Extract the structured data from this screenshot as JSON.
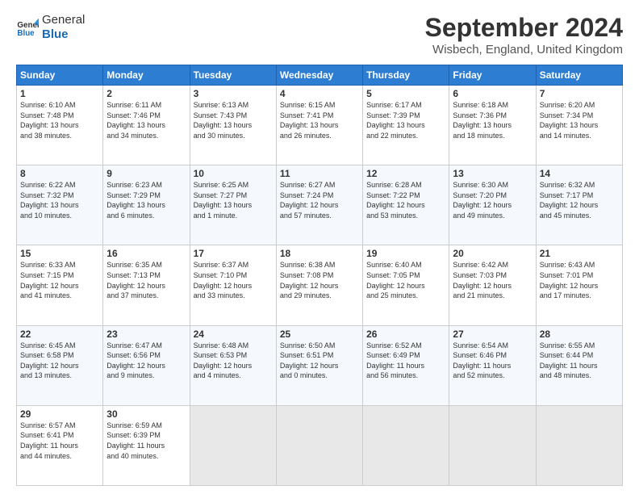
{
  "logo": {
    "general": "General",
    "blue": "Blue"
  },
  "title": "September 2024",
  "subtitle": "Wisbech, England, United Kingdom",
  "days_of_week": [
    "Sunday",
    "Monday",
    "Tuesday",
    "Wednesday",
    "Thursday",
    "Friday",
    "Saturday"
  ],
  "weeks": [
    [
      {
        "day": "1",
        "info": "Sunrise: 6:10 AM\nSunset: 7:48 PM\nDaylight: 13 hours\nand 38 minutes."
      },
      {
        "day": "2",
        "info": "Sunrise: 6:11 AM\nSunset: 7:46 PM\nDaylight: 13 hours\nand 34 minutes."
      },
      {
        "day": "3",
        "info": "Sunrise: 6:13 AM\nSunset: 7:43 PM\nDaylight: 13 hours\nand 30 minutes."
      },
      {
        "day": "4",
        "info": "Sunrise: 6:15 AM\nSunset: 7:41 PM\nDaylight: 13 hours\nand 26 minutes."
      },
      {
        "day": "5",
        "info": "Sunrise: 6:17 AM\nSunset: 7:39 PM\nDaylight: 13 hours\nand 22 minutes."
      },
      {
        "day": "6",
        "info": "Sunrise: 6:18 AM\nSunset: 7:36 PM\nDaylight: 13 hours\nand 18 minutes."
      },
      {
        "day": "7",
        "info": "Sunrise: 6:20 AM\nSunset: 7:34 PM\nDaylight: 13 hours\nand 14 minutes."
      }
    ],
    [
      {
        "day": "8",
        "info": "Sunrise: 6:22 AM\nSunset: 7:32 PM\nDaylight: 13 hours\nand 10 minutes."
      },
      {
        "day": "9",
        "info": "Sunrise: 6:23 AM\nSunset: 7:29 PM\nDaylight: 13 hours\nand 6 minutes."
      },
      {
        "day": "10",
        "info": "Sunrise: 6:25 AM\nSunset: 7:27 PM\nDaylight: 13 hours\nand 1 minute."
      },
      {
        "day": "11",
        "info": "Sunrise: 6:27 AM\nSunset: 7:24 PM\nDaylight: 12 hours\nand 57 minutes."
      },
      {
        "day": "12",
        "info": "Sunrise: 6:28 AM\nSunset: 7:22 PM\nDaylight: 12 hours\nand 53 minutes."
      },
      {
        "day": "13",
        "info": "Sunrise: 6:30 AM\nSunset: 7:20 PM\nDaylight: 12 hours\nand 49 minutes."
      },
      {
        "day": "14",
        "info": "Sunrise: 6:32 AM\nSunset: 7:17 PM\nDaylight: 12 hours\nand 45 minutes."
      }
    ],
    [
      {
        "day": "15",
        "info": "Sunrise: 6:33 AM\nSunset: 7:15 PM\nDaylight: 12 hours\nand 41 minutes."
      },
      {
        "day": "16",
        "info": "Sunrise: 6:35 AM\nSunset: 7:13 PM\nDaylight: 12 hours\nand 37 minutes."
      },
      {
        "day": "17",
        "info": "Sunrise: 6:37 AM\nSunset: 7:10 PM\nDaylight: 12 hours\nand 33 minutes."
      },
      {
        "day": "18",
        "info": "Sunrise: 6:38 AM\nSunset: 7:08 PM\nDaylight: 12 hours\nand 29 minutes."
      },
      {
        "day": "19",
        "info": "Sunrise: 6:40 AM\nSunset: 7:05 PM\nDaylight: 12 hours\nand 25 minutes."
      },
      {
        "day": "20",
        "info": "Sunrise: 6:42 AM\nSunset: 7:03 PM\nDaylight: 12 hours\nand 21 minutes."
      },
      {
        "day": "21",
        "info": "Sunrise: 6:43 AM\nSunset: 7:01 PM\nDaylight: 12 hours\nand 17 minutes."
      }
    ],
    [
      {
        "day": "22",
        "info": "Sunrise: 6:45 AM\nSunset: 6:58 PM\nDaylight: 12 hours\nand 13 minutes."
      },
      {
        "day": "23",
        "info": "Sunrise: 6:47 AM\nSunset: 6:56 PM\nDaylight: 12 hours\nand 9 minutes."
      },
      {
        "day": "24",
        "info": "Sunrise: 6:48 AM\nSunset: 6:53 PM\nDaylight: 12 hours\nand 4 minutes."
      },
      {
        "day": "25",
        "info": "Sunrise: 6:50 AM\nSunset: 6:51 PM\nDaylight: 12 hours\nand 0 minutes."
      },
      {
        "day": "26",
        "info": "Sunrise: 6:52 AM\nSunset: 6:49 PM\nDaylight: 11 hours\nand 56 minutes."
      },
      {
        "day": "27",
        "info": "Sunrise: 6:54 AM\nSunset: 6:46 PM\nDaylight: 11 hours\nand 52 minutes."
      },
      {
        "day": "28",
        "info": "Sunrise: 6:55 AM\nSunset: 6:44 PM\nDaylight: 11 hours\nand 48 minutes."
      }
    ],
    [
      {
        "day": "29",
        "info": "Sunrise: 6:57 AM\nSunset: 6:41 PM\nDaylight: 11 hours\nand 44 minutes."
      },
      {
        "day": "30",
        "info": "Sunrise: 6:59 AM\nSunset: 6:39 PM\nDaylight: 11 hours\nand 40 minutes."
      },
      {
        "day": "",
        "info": ""
      },
      {
        "day": "",
        "info": ""
      },
      {
        "day": "",
        "info": ""
      },
      {
        "day": "",
        "info": ""
      },
      {
        "day": "",
        "info": ""
      }
    ]
  ]
}
